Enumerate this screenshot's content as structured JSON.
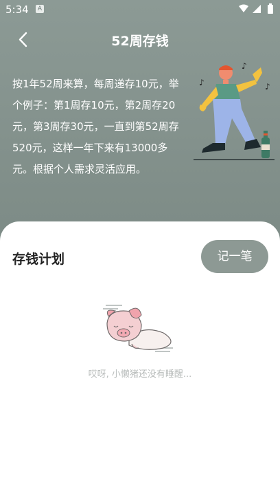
{
  "status_bar": {
    "time": "5:34",
    "notification_letter": "A",
    "icons": [
      "wifi-icon",
      "signal-icon",
      "battery-icon"
    ]
  },
  "header": {
    "title": "52周存钱",
    "back_icon": "chevron-left-icon"
  },
  "intro_text": "按1年52周来算，每周递存10元，举个例子：第1周存10元，第2周存20元，第3周存30元，一直到第52周存520元，这样一年下来有13000多元。根据个人需求灵活应用。",
  "plan": {
    "title": "存钱计划",
    "record_button": "记一笔",
    "empty_text": "哎呀, 小懒猪还没有睡醒..."
  },
  "colors": {
    "background": "#7e8c87",
    "button": "#8d9994",
    "sheet": "#ffffff"
  }
}
